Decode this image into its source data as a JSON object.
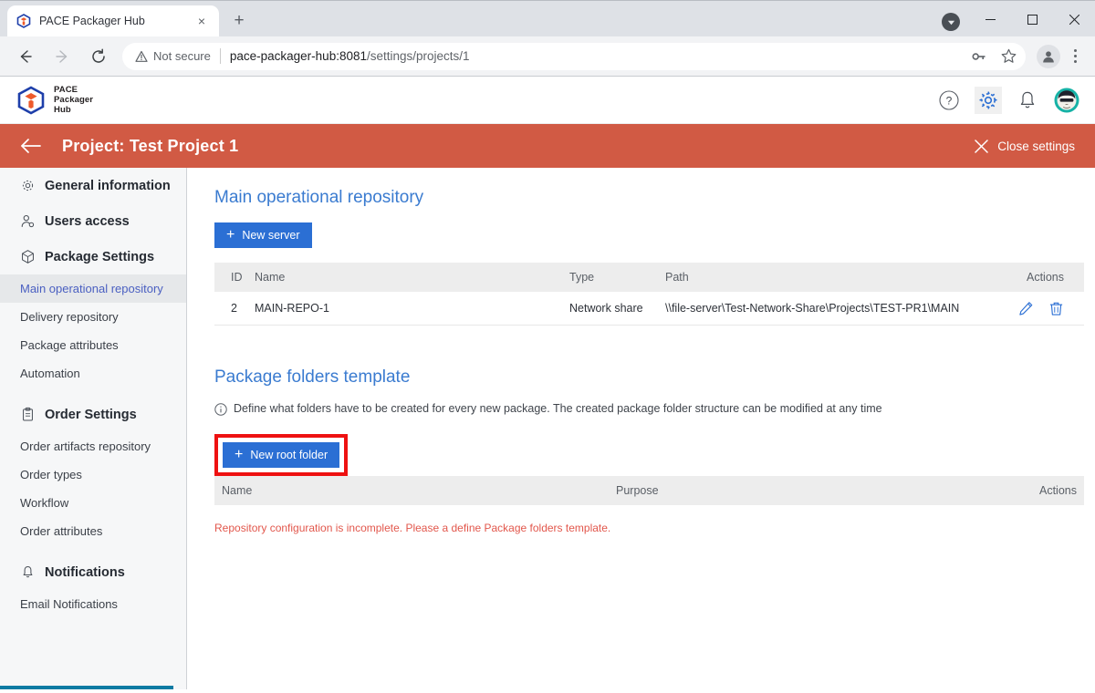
{
  "browser": {
    "tab": {
      "title": "PACE Packager Hub",
      "favicon": "pace-cube-favicon",
      "close": "×"
    },
    "new_tab_label": "+",
    "window_controls": {
      "minimize": "—",
      "maximize": "☐",
      "close": "✕"
    },
    "download_indicator": "download-chevron",
    "nav": {
      "back": "←",
      "forward": "→",
      "reload": "↻"
    },
    "omnibox": {
      "security_label": "Not secure",
      "url_host": "pace-packager-hub:8081",
      "url_path": "/settings/projects/1",
      "icons": [
        "key-icon",
        "star-icon"
      ]
    },
    "profile_icon": "profile-avatar-icon",
    "menu_icon": "kebab-menu-icon"
  },
  "app_header": {
    "logo_alt": "pace-packager-hub-logo",
    "brand_lines": [
      "PACE",
      "Packager",
      "Hub"
    ],
    "actions": [
      {
        "name": "help-icon",
        "label": "?"
      },
      {
        "name": "gear-icon",
        "label": ""
      },
      {
        "name": "bell-icon",
        "label": ""
      },
      {
        "name": "avatar",
        "label": ""
      }
    ]
  },
  "project_bar": {
    "back_arrow": "←",
    "title": "Project: Test Project 1",
    "close_settings_label": "Close settings",
    "close_icon": "✕",
    "bg_color": "#d15a44"
  },
  "sidebar": {
    "groups": [
      {
        "icon": "gear-icon",
        "label": "General information",
        "items": []
      },
      {
        "icon": "users-access-icon",
        "label": "Users access",
        "items": []
      },
      {
        "icon": "package-cube-icon",
        "label": "Package Settings",
        "items": [
          {
            "label": "Main operational repository",
            "selected": true
          },
          {
            "label": "Delivery repository",
            "selected": false
          },
          {
            "label": "Package attributes",
            "selected": false
          },
          {
            "label": "Automation",
            "selected": false
          }
        ]
      },
      {
        "icon": "clipboard-icon",
        "label": "Order Settings",
        "items": [
          {
            "label": "Order artifacts repository",
            "selected": false
          },
          {
            "label": "Order types",
            "selected": false
          },
          {
            "label": "Workflow",
            "selected": false
          },
          {
            "label": "Order attributes",
            "selected": false
          }
        ]
      },
      {
        "icon": "bell-icon",
        "label": "Notifications",
        "items": [
          {
            "label": "Email Notifications",
            "selected": false
          }
        ]
      }
    ]
  },
  "main": {
    "repo_section": {
      "title": "Main operational repository",
      "new_server_button": "New server",
      "columns": [
        "ID",
        "Name",
        "Type",
        "Path",
        "Actions"
      ],
      "rows": [
        {
          "id": "2",
          "name": "MAIN-REPO-1",
          "type": "Network share",
          "path": "\\\\file-server\\Test-Network-Share\\Projects\\TEST-PR1\\MAIN",
          "actions": [
            "edit-pencil-icon",
            "delete-trash-icon"
          ]
        }
      ]
    },
    "folders_section": {
      "title": "Package folders template",
      "hint_icon": "info-icon",
      "hint": "Define what folders have to be created for every new package. The created package folder structure can be modified at any time",
      "new_root_folder_button": "New root folder",
      "highlight_color": "#ee1111",
      "columns": [
        "Name",
        "Purpose",
        "Actions"
      ],
      "rows": [],
      "error_message": "Repository configuration is incomplete. Please a define Package folders template."
    }
  },
  "colors": {
    "accent_blue": "#2b6fd4",
    "link_blue": "#3a7bd0",
    "project_orange": "#d15a44",
    "error_red": "#e2574c",
    "highlight_red": "#ee1111",
    "scrollbar_teal": "#0d7ba3"
  }
}
